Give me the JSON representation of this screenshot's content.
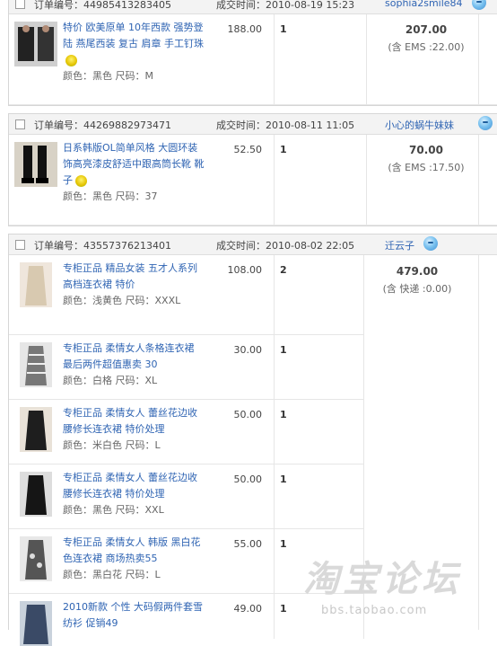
{
  "orders": [
    {
      "order_no": "订单编号：44985413283405",
      "time": "成交时间：2010-08-19 15:23",
      "seller": "sophia2smile84",
      "total": "207.00",
      "shipping": "(含 EMS :22.00)",
      "items": [
        {
          "title": "特价 欧美原单 10年西款 强势登陆 燕尾西装 复古 肩章 手工钉珠",
          "attrs": "颜色：黑色   尺码：M",
          "price": "188.00",
          "qty": "1"
        }
      ]
    },
    {
      "order_no": "订单编号：44269882973471",
      "time": "成交时间：2010-08-11 11:05",
      "seller": "小心的蜗牛妹妹",
      "total": "70.00",
      "shipping": "(含 EMS :17.50)",
      "items": [
        {
          "title": "日系韩版OL简单风格 大圆环装饰高亮漆皮舒适中跟高筒长靴 靴子",
          "attrs": "颜色：黑色   尺码：37",
          "price": "52.50",
          "qty": "1"
        }
      ]
    },
    {
      "order_no": "订单编号：43557376213401",
      "time": "成交时间：2010-08-02 22:05",
      "seller": "迁云子",
      "total": "479.00",
      "shipping": "(含 快递 :0.00)",
      "items": [
        {
          "title": "专柜正品 精品女装 五才人系列 高档连衣裙 特价",
          "attrs": "颜色：浅黄色   尺码：XXXL",
          "price": "108.00",
          "qty": "2"
        },
        {
          "title": "专柜正品 柔情女人条格连衣裙 最后两件超值惠卖 30",
          "attrs": "颜色：白格   尺码：XL",
          "price": "30.00",
          "qty": "1"
        },
        {
          "title": "专柜正品 柔情女人 蕾丝花边收腰修长连衣裙 特价处理",
          "attrs": "颜色：米白色   尺码：L",
          "price": "50.00",
          "qty": "1"
        },
        {
          "title": "专柜正品 柔情女人 蕾丝花边收腰修长连衣裙 特价处理",
          "attrs": "颜色：黑色   尺码：XXL",
          "price": "50.00",
          "qty": "1"
        },
        {
          "title": "专柜正品 柔情女人 韩版 黑白花色连衣裙 商场热卖55",
          "attrs": "颜色：黑白花   尺码：L",
          "price": "55.00",
          "qty": "1"
        },
        {
          "title": "2010新款 个性 大码假两件套雪纺衫 促销49",
          "attrs": "",
          "price": "49.00",
          "qty": "1"
        }
      ]
    }
  ],
  "watermark": {
    "logo": "淘宝论坛",
    "url": "bbs.taobao.com"
  },
  "colors": {
    "link": "#2f64b3",
    "header_bg": "#f3f3f3",
    "border": "#d6d6d6"
  }
}
